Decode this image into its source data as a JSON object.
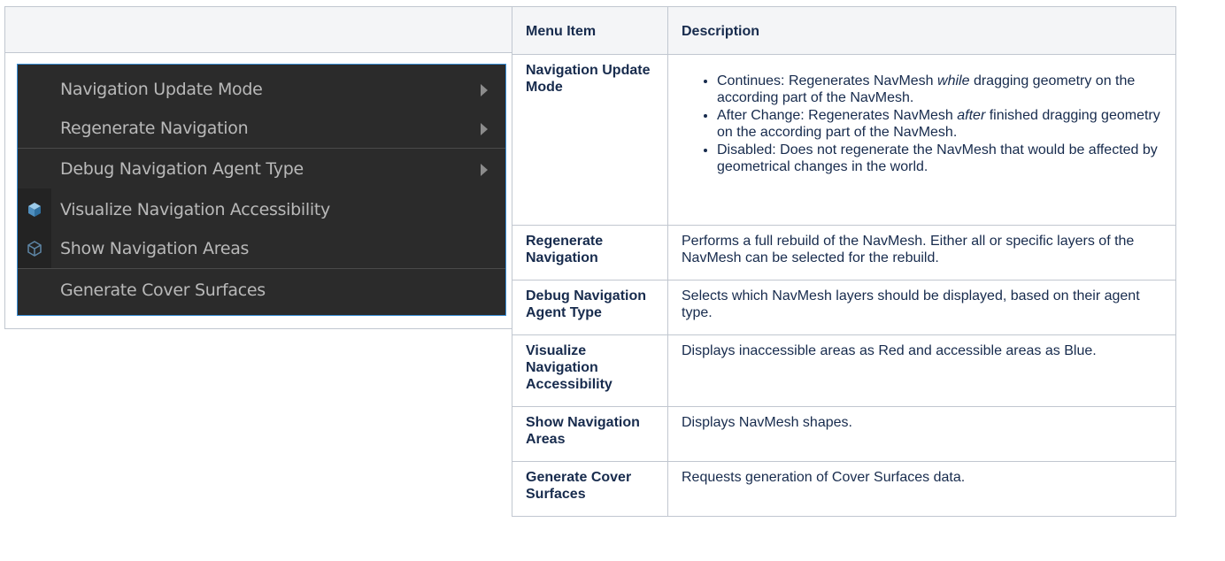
{
  "menu": {
    "items": [
      {
        "label": "Navigation Update Mode",
        "icon": "",
        "submenu": true
      },
      {
        "label": "Regenerate Navigation",
        "icon": "",
        "submenu": true
      },
      {
        "label": "Debug Navigation Agent Type",
        "icon": "",
        "submenu": true
      },
      {
        "label": "Visualize Navigation Accessibility",
        "icon": "cube-icon",
        "submenu": false
      },
      {
        "label": "Show Navigation Areas",
        "icon": "cube-outline-icon",
        "submenu": false
      },
      {
        "label": "Generate Cover Surfaces",
        "icon": "",
        "submenu": false
      }
    ]
  },
  "table": {
    "headers": [
      "Menu Item",
      "Description"
    ],
    "rows": [
      {
        "name": "Navigation Update Mode",
        "bullets": [
          {
            "pre": "Continues: Regenerates NavMesh ",
            "em": "while",
            "post": " dragging geometry on the according part of the NavMesh."
          },
          {
            "pre": "After Change: Regenerates NavMesh ",
            "em": "after",
            "post": " finished dragging geometry on the according part of the NavMesh."
          },
          {
            "pre": "Disabled: Does not regenerate the NavMesh that would be affected by geometrical changes in the world.",
            "em": "",
            "post": ""
          }
        ]
      },
      {
        "name": "Regenerate Navigation",
        "desc": "Performs a full rebuild of the NavMesh. Either all or specific layers of the NavMesh can be selected for the rebuild."
      },
      {
        "name": "Debug Navigation Agent Type",
        "desc": "Selects which NavMesh layers should be displayed, based on their agent type."
      },
      {
        "name": "Visualize Navigation Accessibility",
        "desc": "Displays inaccessible areas as Red and accessible areas as Blue."
      },
      {
        "name": "Show Navigation Areas",
        "desc": "Displays NavMesh shapes."
      },
      {
        "name": "Generate Cover Surfaces",
        "desc": "Requests generation of Cover Surfaces data."
      }
    ]
  },
  "colors": {
    "menu_bg": "#2b2b2b",
    "menu_border": "#3a8fd6",
    "menu_text": "#b9b9b9",
    "header_bg": "#f4f5f7",
    "table_border": "#c1c7d0"
  }
}
